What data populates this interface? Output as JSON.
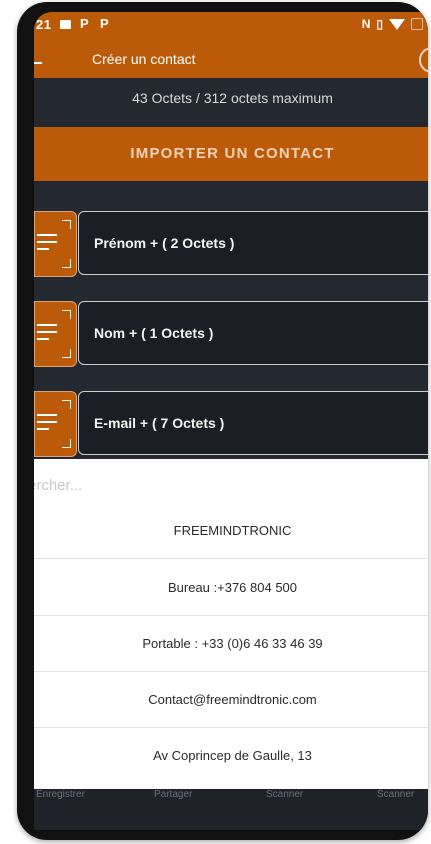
{
  "status": {
    "time": "21",
    "p1": "P",
    "p2": "P",
    "nfc": "N"
  },
  "appbar": {
    "title": "Créer un contact"
  },
  "info": {
    "bytes": "43 Octets / 312 octets maximum"
  },
  "import": {
    "label": "IMPORTER UN CONTACT"
  },
  "fields": [
    {
      "label": "Prénom + ( 2 Octets )"
    },
    {
      "label": "Nom + ( 1 Octets )"
    },
    {
      "label": "E-mail + ( 7 Octets )"
    }
  ],
  "sheet": {
    "search_placeholder": "ercher...",
    "items": [
      "FREEMINDTRONIC",
      "Bureau :+376 804 500",
      "Portable : +33 (0)6 46 33 46 39",
      "Contact@freemindtronic.com",
      "Av Coprincep de Gaulle, 13"
    ]
  },
  "nav": {
    "items": [
      "Enregistrer",
      "Partager",
      "Scanner",
      "Scanner"
    ]
  },
  "colors": {
    "accent": "#bb5b09",
    "background": "#242831",
    "field": "#1b1e24"
  }
}
